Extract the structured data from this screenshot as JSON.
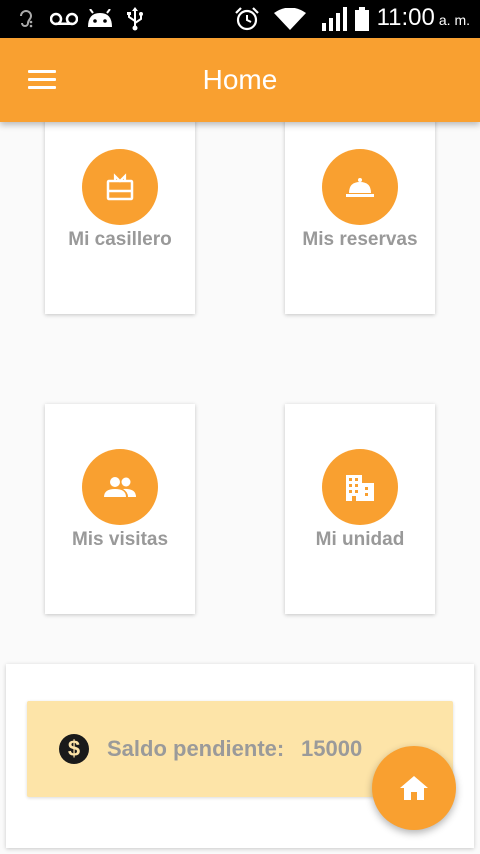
{
  "status_bar": {
    "time": "11:00",
    "ampm": "a. m.",
    "icons": [
      "hearing-aid-icon",
      "voicemail-icon",
      "android-icon",
      "usb-icon",
      "alarm-icon",
      "wifi-icon",
      "signal-icon",
      "battery-icon"
    ]
  },
  "app_bar": {
    "title": "Home",
    "menu_icon": "menu-icon"
  },
  "cards": [
    {
      "label": "Mi casillero",
      "icon": "locker-icon"
    },
    {
      "label": "Mis reservas",
      "icon": "room-service-icon"
    },
    {
      "label": "Mis visitas",
      "icon": "people-icon"
    },
    {
      "label": "Mi unidad",
      "icon": "building-icon"
    }
  ],
  "balance": {
    "label": "Saldo pendiente:",
    "value": "15000",
    "icon": "dollar-icon"
  },
  "fab": {
    "icon": "home-icon"
  },
  "colors": {
    "accent": "#f9a030",
    "balance_bg": "#fde4a8",
    "label_gray": "#999999"
  }
}
